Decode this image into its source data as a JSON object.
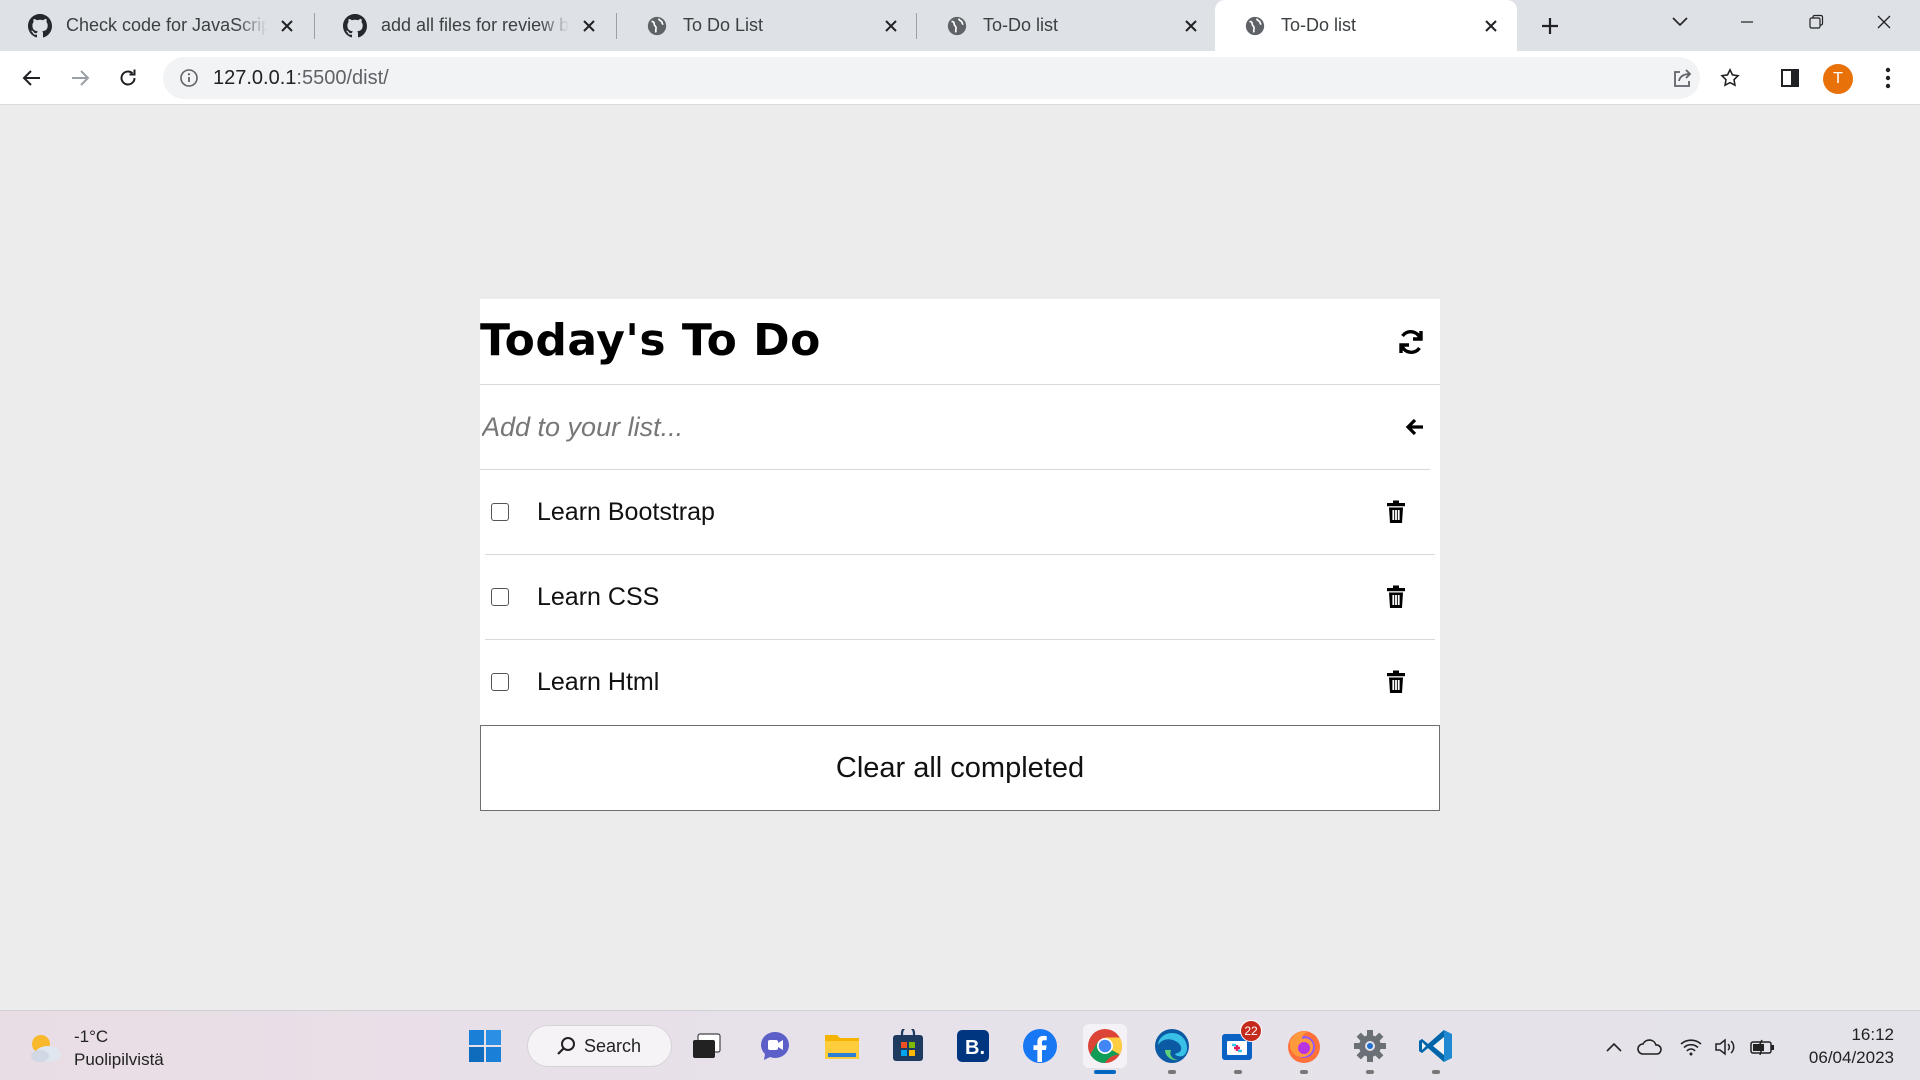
{
  "browser": {
    "tabs": [
      {
        "title": "Check code for JavaScript",
        "icon": "github-icon",
        "active": false
      },
      {
        "title": "add all files for review by",
        "icon": "github-icon",
        "active": false
      },
      {
        "title": "To Do List",
        "icon": "globe-icon",
        "active": false
      },
      {
        "title": "To-Do list",
        "icon": "globe-icon",
        "active": false
      },
      {
        "title": "To-Do list",
        "icon": "globe-icon",
        "active": true
      }
    ],
    "url_host": "127.0.0.1",
    "url_path": ":5500/dist/",
    "profile_initial": "T",
    "profile_color": "#e8710a"
  },
  "app": {
    "title": "Today's To Do",
    "input_placeholder": "Add to your list...",
    "todos": [
      {
        "label": "Learn Bootstrap",
        "completed": false
      },
      {
        "label": "Learn CSS",
        "completed": false
      },
      {
        "label": "Learn Html",
        "completed": false
      }
    ],
    "clear_label": "Clear all completed"
  },
  "taskbar": {
    "weather_temp": "-1°C",
    "weather_desc": "Puolipilvistä",
    "search_label": "Search",
    "notification_count": "22",
    "time": "16:12",
    "date": "06/04/2023"
  }
}
